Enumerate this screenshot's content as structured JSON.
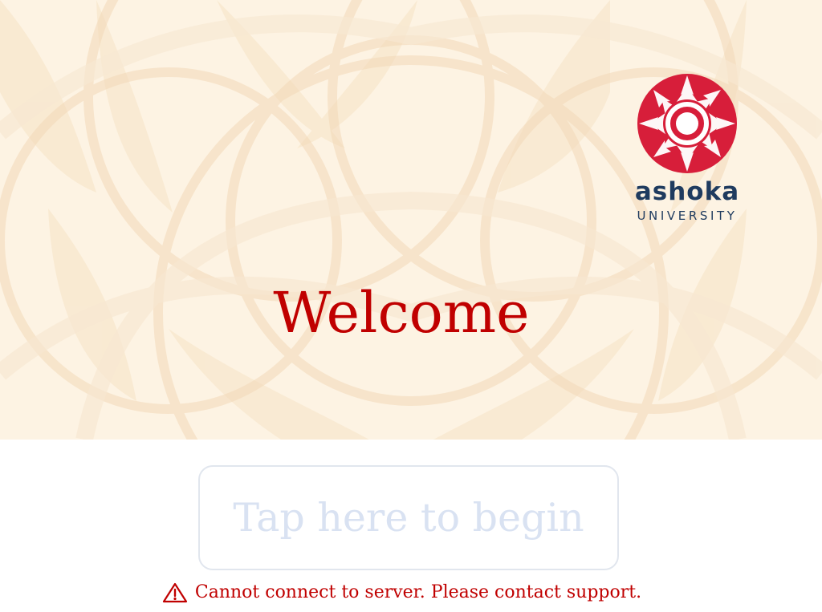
{
  "brand": {
    "name": "ashoka",
    "subtitle": "UNIVERSITY",
    "primary_color": "#c00000",
    "logo_color": "#1f3b5f",
    "mark_colors": [
      "#d71e3a",
      "#ffffff"
    ]
  },
  "hero": {
    "welcome": "Welcome",
    "background_color": "#fdf3e3",
    "pattern_color": "#f6e2c4"
  },
  "start": {
    "label": "Tap here to begin",
    "label_color": "#d9e2f2"
  },
  "status": {
    "icon": "warning-icon",
    "message": "Cannot connect to server. Please contact support.",
    "color": "#c00000"
  }
}
